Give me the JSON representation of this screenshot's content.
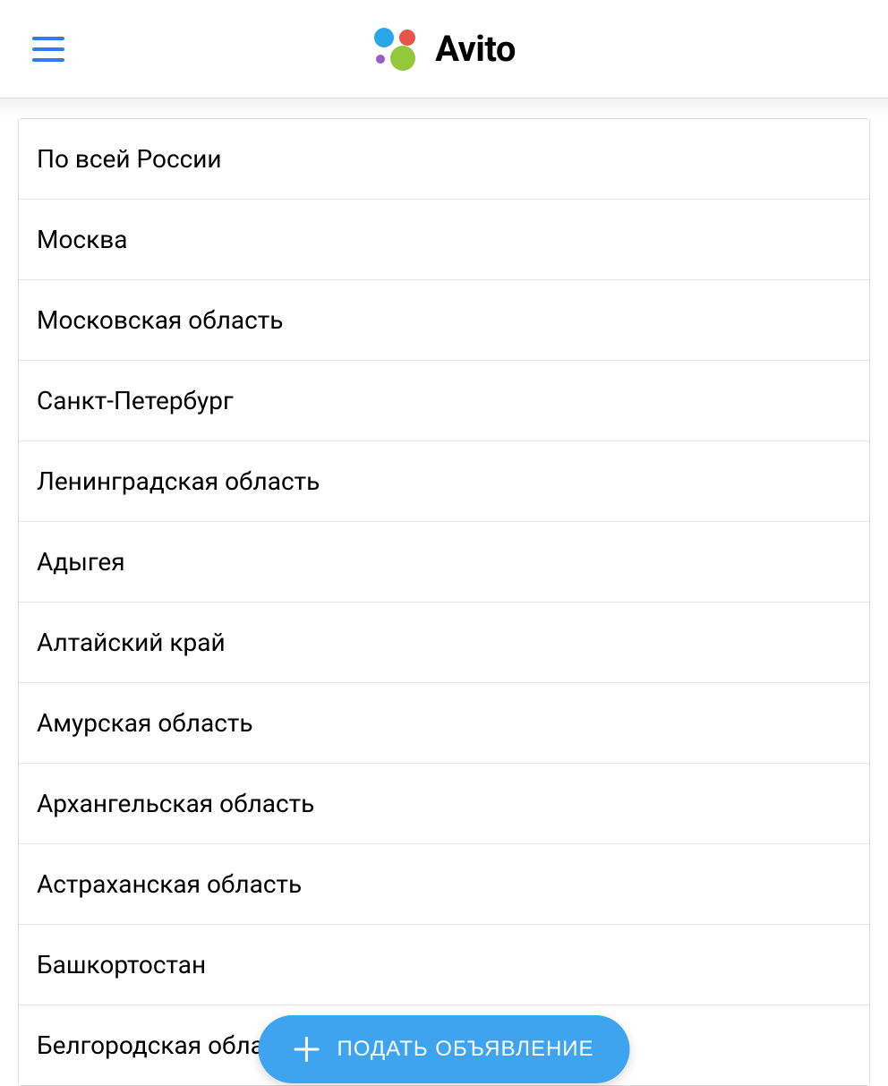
{
  "header": {
    "logo_text": "Avito"
  },
  "regions": [
    "По всей России",
    "Москва",
    "Московская область",
    "Санкт-Петербург",
    "Ленинградская область",
    "Адыгея",
    "Алтайский край",
    "Амурская область",
    "Архангельская область",
    "Астраханская область",
    "Башкортостан",
    "Белгородская область"
  ],
  "fab": {
    "label": "ПОДАТЬ ОБЪЯВЛЕНИЕ"
  }
}
